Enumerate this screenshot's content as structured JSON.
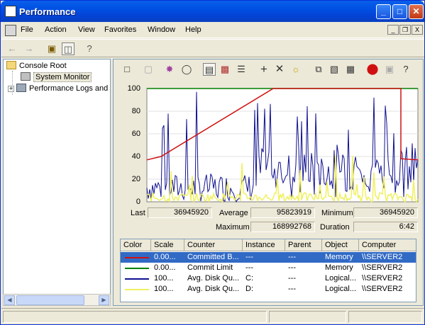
{
  "window": {
    "title": "Performance"
  },
  "menu": [
    "File",
    "Action",
    "View",
    "Favorites",
    "Window",
    "Help"
  ],
  "mdi_controls": [
    "_",
    "❐",
    "X"
  ],
  "tree": {
    "root": "Console Root",
    "system_monitor": "System Monitor",
    "perf_logs": "Performance Logs and Alerts"
  },
  "graph": {
    "y_ticks": [
      "100",
      "80",
      "60",
      "40",
      "20",
      "0"
    ]
  },
  "stats": {
    "last_label": "Last",
    "last_value": "36945920",
    "average_label": "Average",
    "average_value": "95823919",
    "minimum_label": "Minimum",
    "minimum_value": "36945920",
    "maximum_label": "Maximum",
    "maximum_value": "168992768",
    "duration_label": "Duration",
    "duration_value": "6:42"
  },
  "legend": {
    "headers": [
      "Color",
      "Scale",
      "Counter",
      "Instance",
      "Parent",
      "Object",
      "Computer"
    ],
    "rows": [
      {
        "color": "#d01010",
        "scale": "0.00...",
        "counter": "Committed B...",
        "instance": "---",
        "parent": "---",
        "object": "Memory",
        "computer": "\\\\SERVER2",
        "selected": true
      },
      {
        "color": "#008000",
        "scale": "0.00...",
        "counter": "Commit Limit",
        "instance": "---",
        "parent": "---",
        "object": "Memory",
        "computer": "\\\\SERVER2",
        "selected": false
      },
      {
        "color": "#101090",
        "scale": "100...",
        "counter": "Avg. Disk Qu...",
        "instance": "C:",
        "parent": "---",
        "object": "Logical...",
        "computer": "\\\\SERVER2",
        "selected": false
      },
      {
        "color": "#f0f060",
        "scale": "100...",
        "counter": "Avg. Disk Qu...",
        "instance": "D:",
        "parent": "---",
        "object": "Logical...",
        "computer": "\\\\SERVER2",
        "selected": false
      }
    ]
  }
}
